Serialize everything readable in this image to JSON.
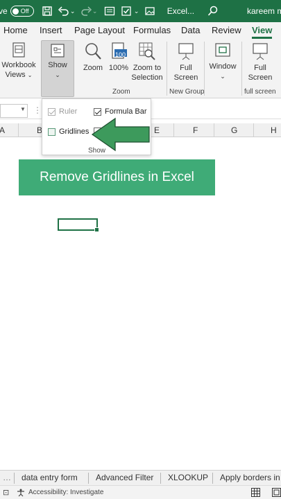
{
  "titlebar": {
    "autosave": "ve",
    "toggle": "Off",
    "title": "Excel...",
    "user": "kareem m"
  },
  "tabs": [
    "Home",
    "Insert",
    "Page Layout",
    "Formulas",
    "Data",
    "Review",
    "View"
  ],
  "ribbon": {
    "workbook_views_line1": "Workbook",
    "workbook_views_line2": "Views",
    "show": "Show",
    "zoom": "Zoom",
    "zoom100": "100%",
    "zoom100_badge": "100",
    "zoom_to_line1": "Zoom to",
    "zoom_to_line2": "Selection",
    "zoom_group": "Zoom",
    "full_screen_line1": "Full",
    "full_screen_line2": "Screen",
    "new_group": "New Group",
    "window": "Window",
    "full_screen2_line1": "Full",
    "full_screen2_line2": "Screen",
    "full_screen_group": "full screen"
  },
  "show_dropdown": {
    "ruler": "Ruler",
    "formula_bar": "Formula Bar",
    "gridlines": "Gridlines",
    "group_label": "Show"
  },
  "columns": [
    "A",
    "B",
    "E",
    "F",
    "G",
    "H"
  ],
  "banner": "Remove Gridlines in Excel",
  "sheet_tabs": [
    "data entry form",
    "Advanced Filter",
    "XLOOKUP",
    "Apply borders in"
  ],
  "status": {
    "accessibility": "Accessibility: Investigate"
  },
  "colors": {
    "excel_green": "#1e7145",
    "banner_green": "#3fab77",
    "arrow_green": "#3d9a5c"
  }
}
